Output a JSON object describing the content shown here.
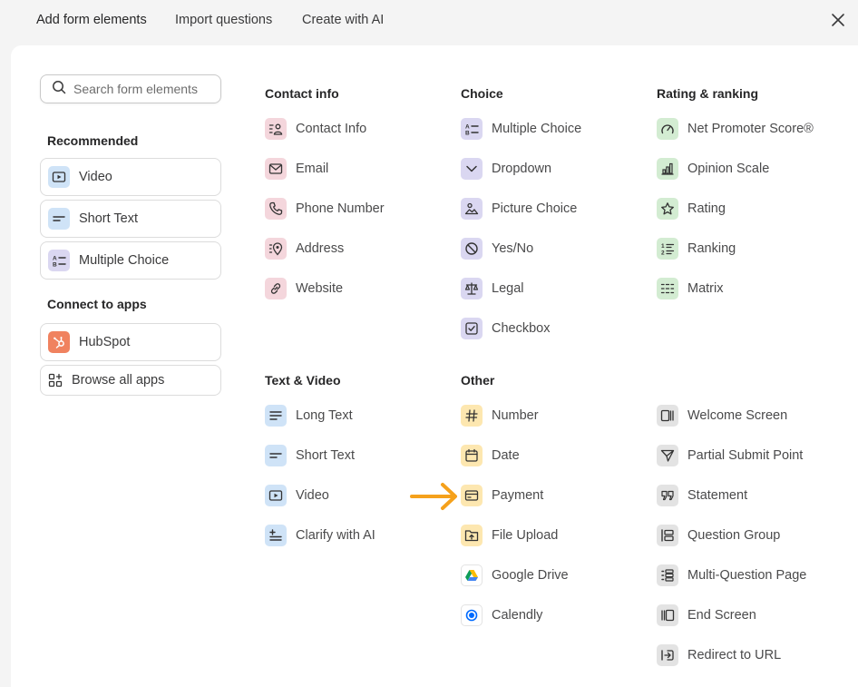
{
  "tabs": [
    "Add form elements",
    "Import questions",
    "Create with AI"
  ],
  "search": {
    "placeholder": "Search form elements"
  },
  "sidebar": {
    "recommended_heading": "Recommended",
    "recommended": [
      "Video",
      "Short Text",
      "Multiple Choice"
    ],
    "connect_heading": "Connect to apps",
    "hubspot": "HubSpot",
    "browse": "Browse all apps"
  },
  "columns": {
    "contact": {
      "heading": "Contact info",
      "items": [
        "Contact Info",
        "Email",
        "Phone Number",
        "Address",
        "Website"
      ]
    },
    "choice": {
      "heading": "Choice",
      "items": [
        "Multiple Choice",
        "Dropdown",
        "Picture Choice",
        "Yes/No",
        "Legal",
        "Checkbox"
      ]
    },
    "rating": {
      "heading": "Rating & ranking",
      "items": [
        "Net Promoter Score®",
        "Opinion Scale",
        "Rating",
        "Ranking",
        "Matrix"
      ]
    },
    "text_video": {
      "heading": "Text & Video",
      "items": [
        "Long Text",
        "Short Text",
        "Video",
        "Clarify with AI"
      ]
    },
    "other": {
      "heading": "Other",
      "items": [
        "Number",
        "Date",
        "Payment",
        "File Upload",
        "Google Drive",
        "Calendly"
      ]
    },
    "screens": {
      "items": [
        "Welcome Screen",
        "Partial Submit Point",
        "Statement",
        "Question Group",
        "Multi-Question Page",
        "End Screen",
        "Redirect to URL"
      ]
    }
  },
  "colors": {
    "contact": "#f4d6dc",
    "choice": "#dad7f1",
    "rating": "#d3ecd2",
    "text_video": "#cfe3f7",
    "other": "#fde7b0",
    "screens": "#e3e3e3",
    "hubspot": "#f0825f",
    "annotation_arrow": "#f5a11c"
  }
}
